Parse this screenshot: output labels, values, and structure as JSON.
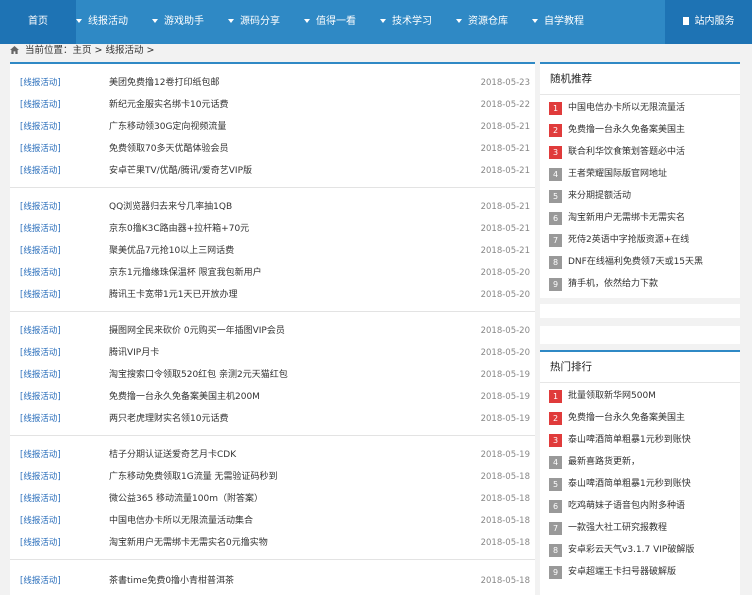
{
  "nav": {
    "home": "首页",
    "items": [
      "线报活动",
      "游戏助手",
      "源码分享",
      "值得一看",
      "技术学习",
      "资源仓库",
      "自学教程"
    ],
    "service": "站内服务"
  },
  "breadcrumb": "当前位置：主页 > 线报活动 >",
  "groups": [
    [
      {
        "cat": "[线报活动]",
        "title": "美团免费撸12卷打印纸包邮",
        "date": "2018-05-23"
      },
      {
        "cat": "[线报活动]",
        "title": "新纪元金服实名绑卡10元话费",
        "date": "2018-05-22"
      },
      {
        "cat": "[线报活动]",
        "title": "广东移动领30G定向视频流量",
        "date": "2018-05-21"
      },
      {
        "cat": "[线报活动]",
        "title": "免费领取70多天优酷体验会员",
        "date": "2018-05-21"
      },
      {
        "cat": "[线报活动]",
        "title": "安卓芒果TV/优酷/腾讯/爱奇艺VIP版",
        "date": "2018-05-21"
      }
    ],
    [
      {
        "cat": "[线报活动]",
        "title": "QQ浏览器归去来兮几率抽1QB",
        "date": "2018-05-21"
      },
      {
        "cat": "[线报活动]",
        "title": "京东0撸K3C路由器+拉杆箱+70元",
        "date": "2018-05-21"
      },
      {
        "cat": "[线报活动]",
        "title": "聚美优品7元抢10以上三网话费",
        "date": "2018-05-21"
      },
      {
        "cat": "[线报活动]",
        "title": "京东1元撸缘珠保温杯 限宜我包新用户",
        "date": "2018-05-20"
      },
      {
        "cat": "[线报活动]",
        "title": "腾讯王卡宽带1元1天已开放办理",
        "date": "2018-05-20"
      }
    ],
    [
      {
        "cat": "[线报活动]",
        "title": "摄图网全民来砍价 0元购买一年插图VIP会员",
        "date": "2018-05-20"
      },
      {
        "cat": "[线报活动]",
        "title": "腾讯VIP月卡",
        "date": "2018-05-20"
      },
      {
        "cat": "[线报活动]",
        "title": "淘宝搜索口令领取520红包 亲测2元天猫红包",
        "date": "2018-05-19"
      },
      {
        "cat": "[线报活动]",
        "title": "免费撸一台永久免备案美国主机200M",
        "date": "2018-05-19"
      },
      {
        "cat": "[线报活动]",
        "title": "两只老虎理财实名领10元话费",
        "date": "2018-05-19"
      }
    ],
    [
      {
        "cat": "[线报活动]",
        "title": "桔子分期认证送爱奇艺月卡CDK",
        "date": "2018-05-19"
      },
      {
        "cat": "[线报活动]",
        "title": "广东移动免费领取1G流量 无需验证码秒到",
        "date": "2018-05-18"
      },
      {
        "cat": "[线报活动]",
        "title": "微公益365 移动流量100m（附答案）",
        "date": "2018-05-18"
      },
      {
        "cat": "[线报活动]",
        "title": "中国电信办卡所以无限流量活动集合",
        "date": "2018-05-18"
      },
      {
        "cat": "[线报活动]",
        "title": "淘宝新用户无需绑卡无需实名0元撸实物",
        "date": "2018-05-18"
      }
    ],
    [
      {
        "cat": "[线报活动]",
        "title": "茶書time免费0撸小青柑普洱茶",
        "date": "2018-05-18"
      }
    ]
  ],
  "random": {
    "title": "随机推荐",
    "items": [
      "中国电信办卡所以无限流量活",
      "免费撸一台永久免备案美国主",
      "联合利华饮食策划答题必中活",
      "王者荣耀国际版官网地址",
      "来分期提额活动",
      "淘宝新用户无需绑卡无需实名",
      "死侍2英语中字抢版资源+在线",
      "DNF在线福利免费领7天或15天黑",
      "猜手机，依然给力下款"
    ]
  },
  "hot": {
    "title": "热门排行",
    "items": [
      "批量领取新华网500M",
      "免费撸一台永久免备案美国主",
      "泰山啤酒简单粗暴1元秒到账快",
      "最新喜路货更新，",
      "泰山啤酒简单粗暴1元秒到账快",
      "吃鸡萌妹子语音包内附多种语",
      "一款强大社工研究报教程",
      "安卓彩云天气v3.1.7 VIP破解版",
      "安卓超端王卡扫号器破解版"
    ]
  },
  "colors": {
    "nav": "#2f89c5",
    "nav_dark": "#1e73b4",
    "rank_red": "#e03b3b",
    "rank_gray": "#999999",
    "link": "#2a6ebb"
  }
}
